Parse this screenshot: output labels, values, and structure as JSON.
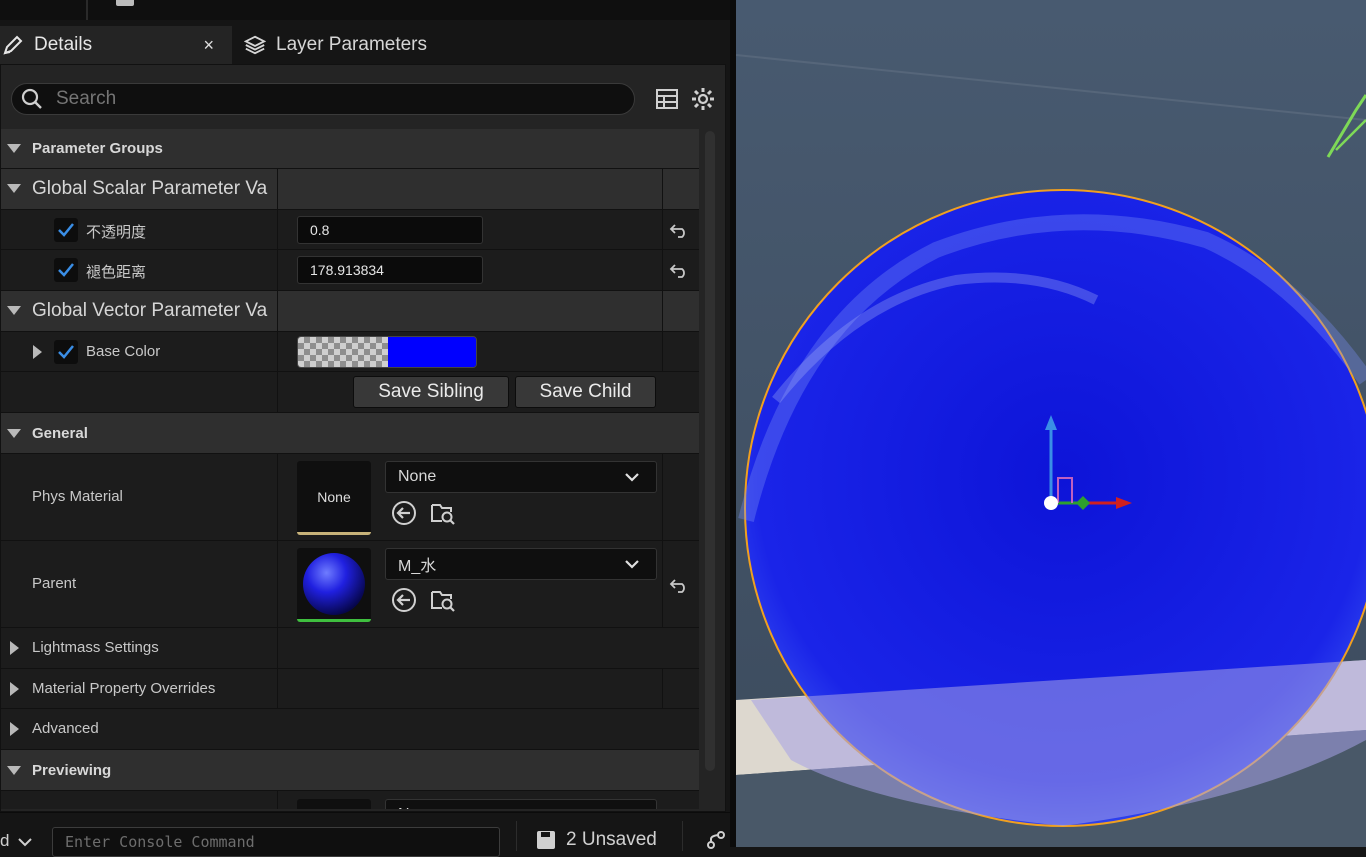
{
  "tabs": {
    "details_label": "Details",
    "layer_params_label": "Layer Parameters",
    "close_glyph": "×"
  },
  "search": {
    "placeholder": "Search"
  },
  "categories": {
    "parameter_groups": "Parameter Groups",
    "global_scalar": "Global Scalar Parameter Va",
    "global_vector": "Global Vector Parameter Va",
    "general": "General",
    "lightmass": "Lightmass Settings",
    "material_overrides": "Material Property Overrides",
    "advanced": "Advanced",
    "previewing": "Previewing"
  },
  "scalar_params": [
    {
      "label": "不透明度",
      "value": "0.8",
      "checked": true
    },
    {
      "label": "褪色距离",
      "value": "178.913834",
      "checked": true
    }
  ],
  "vector_params": [
    {
      "label": "Base Color",
      "checked": true,
      "color": "#0000ff"
    }
  ],
  "buttons": {
    "save_sibling": "Save Sibling",
    "save_child": "Save Child"
  },
  "general": {
    "phys_material": {
      "label": "Phys Material",
      "thumb_text": "None",
      "value": "None",
      "underline_color": "#c8b37a"
    },
    "parent": {
      "label": "Parent",
      "value": "M_水",
      "underline_color": "#3fbf3f"
    }
  },
  "previewing": {
    "partial_value": "N"
  },
  "bottom": {
    "console_placeholder": "Enter Console Command",
    "unsaved": "2 Unsaved",
    "cmd_label": "d"
  },
  "colors": {
    "accent_check": "#3a8ee6",
    "sphere_blue": "#1a1ae6",
    "selection_outline": "#f0a020"
  }
}
